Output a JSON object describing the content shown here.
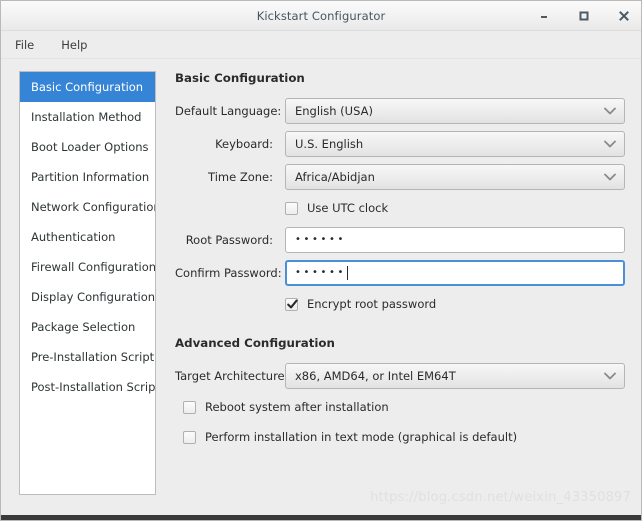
{
  "window": {
    "title": "Kickstart Configurator",
    "controls": [
      {
        "name": "minimize",
        "label": "–"
      },
      {
        "name": "maximize",
        "label": "□"
      },
      {
        "name": "close",
        "label": "×"
      }
    ]
  },
  "menubar": {
    "items": [
      {
        "label": "File"
      },
      {
        "label": "Help"
      }
    ]
  },
  "sidebar": {
    "items": [
      {
        "label": "Basic Configuration",
        "selected": true
      },
      {
        "label": "Installation Method",
        "selected": false
      },
      {
        "label": "Boot Loader Options",
        "selected": false
      },
      {
        "label": "Partition Information",
        "selected": false
      },
      {
        "label": "Network Configuration",
        "selected": false
      },
      {
        "label": "Authentication",
        "selected": false
      },
      {
        "label": "Firewall Configuration",
        "selected": false
      },
      {
        "label": "Display Configuration",
        "selected": false
      },
      {
        "label": "Package Selection",
        "selected": false
      },
      {
        "label": "Pre-Installation Script",
        "selected": false
      },
      {
        "label": "Post-Installation Script",
        "selected": false
      }
    ]
  },
  "basic": {
    "heading": "Basic Configuration",
    "default_language": {
      "label": "Default Language:",
      "value": "English (USA)"
    },
    "keyboard": {
      "label": "Keyboard:",
      "value": "U.S. English"
    },
    "time_zone": {
      "label": "Time Zone:",
      "value": "Africa/Abidjan"
    },
    "use_utc": {
      "label": "Use UTC clock",
      "checked": false
    },
    "root_password": {
      "label": "Root Password:",
      "value": "••••••",
      "focused": false
    },
    "confirm_password": {
      "label": "Confirm Password:",
      "value": "••••••",
      "focused": true
    },
    "encrypt_root": {
      "label": "Encrypt root password",
      "checked": true
    }
  },
  "advanced": {
    "heading": "Advanced Configuration",
    "target_architecture": {
      "label": "Target Architecture:",
      "value": "x86, AMD64, or Intel EM64T"
    },
    "reboot_after_install": {
      "label": "Reboot system after installation",
      "checked": false
    },
    "text_mode": {
      "label": "Perform installation in text mode (graphical is default)",
      "checked": false
    }
  },
  "watermark": {
    "text": "https://blog.csdn.net/weixin_43350897"
  },
  "colors": {
    "accent": "#3584d6",
    "focus": "#4a90d9",
    "window_bg": "#ededed",
    "title_text": "#47565f"
  }
}
